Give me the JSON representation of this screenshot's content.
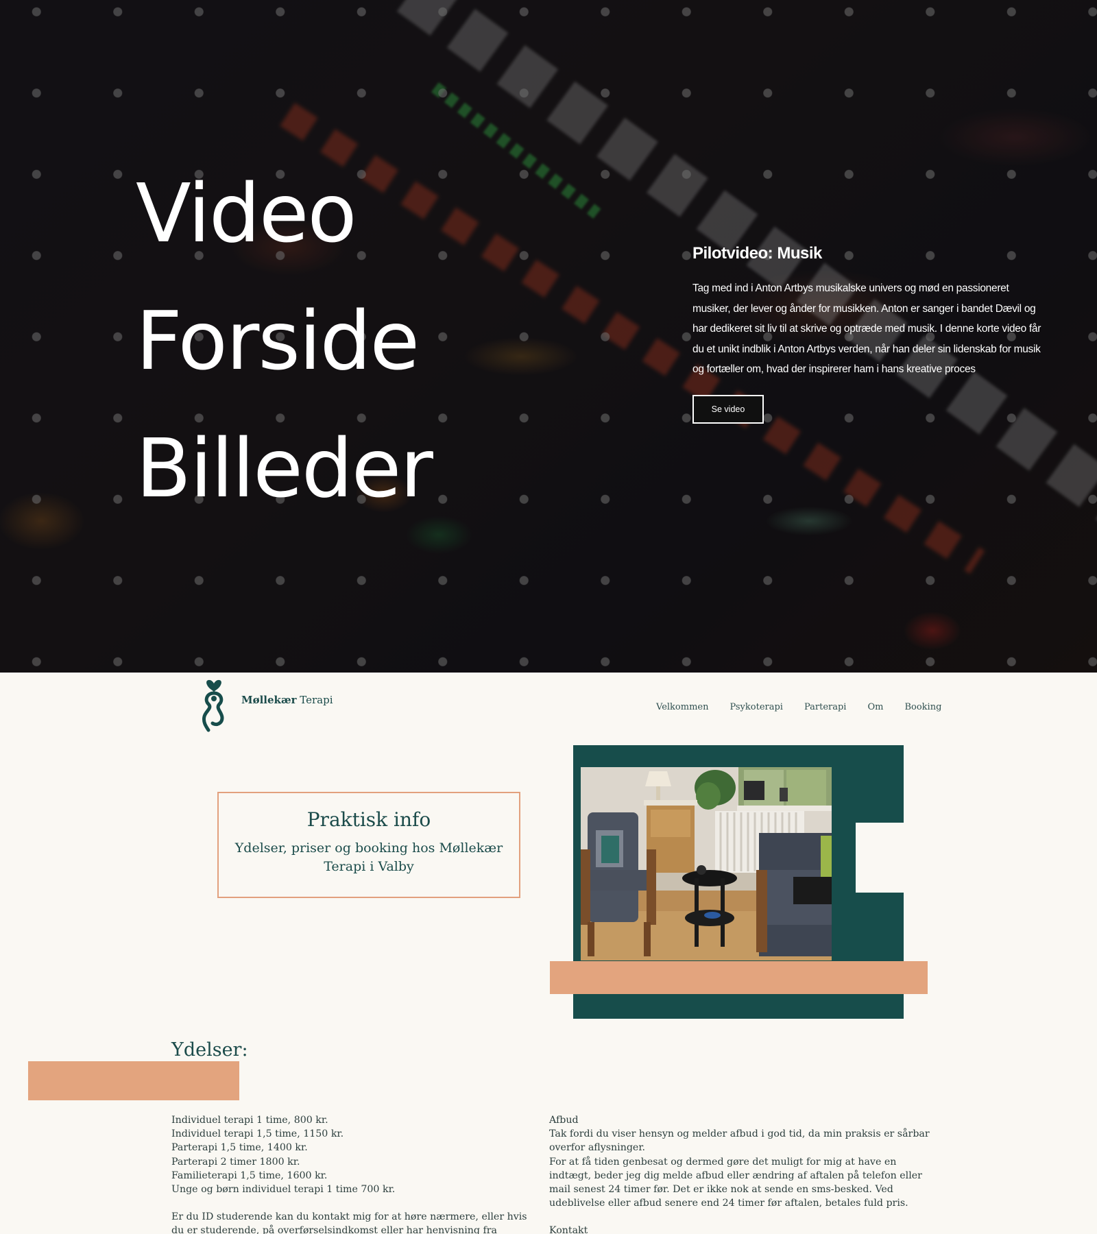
{
  "hero": {
    "title_lines": [
      "Video",
      "Forside",
      "Billeder"
    ],
    "card": {
      "heading": "Pilotvideo: Musik",
      "text": "Tag med ind i Anton Artbys musikalske univers og mød en passioneret musiker, der lever og ånder for musikken. Anton er sanger i bandet Dævil og har dedikeret sit liv til at skrive og optræde med musik. I denne korte video får du et unikt indblik i Anton Artbys verden, når han deler sin lidenskab for musik og fortæller om, hvad der inspirerer ham i hans kreative proces",
      "button_label": "Se video"
    }
  },
  "header": {
    "brand_bold": "Møllekær",
    "brand_rest": "Terapi",
    "nav": [
      "Velkommen",
      "Psykoterapi",
      "Parterapi",
      "Om",
      "Booking"
    ]
  },
  "info_box": {
    "title": "Praktisk info",
    "subtitle": "Ydelser, priser og booking hos Møllekær Terapi i Valby"
  },
  "services": {
    "heading": "Ydelser:",
    "items": [
      "Individuel terapi 1 time, 800 kr.",
      "Individuel terapi 1,5 time, 1150 kr.",
      "Parterapi 1,5 time, 1400 kr.",
      "Parterapi 2 timer 1800 kr.",
      "Familieterapi 1,5 time, 1600 kr.",
      "Unge og børn individuel terapi 1 time 700 kr."
    ],
    "note": "Er du ID studerende kan du kontakt mig for at høre nærmere, eller hvis du er studerende, på overførselsindkomst eller har henvisning fra lægen."
  },
  "cancellation": {
    "heading": "Afbud",
    "text1": "Tak fordi du viser hensyn og melder afbud i god tid, da min praksis er sårbar overfor aflysninger.",
    "text2": "For at få tiden genbesat og dermed gøre det muligt for mig at have en indtægt, beder jeg dig melde afbud eller ændring af aftalen på telefon eller mail senest 24 timer før. Det er ikke nok at sende en sms-besked. Ved udeblivelse eller afbud senere end 24 timer før aftalen, betales fuld pris.",
    "contact_heading": "Kontakt"
  },
  "colors": {
    "teal": "#174d4b",
    "peach": "#e3a47e",
    "cream": "#faf8f3"
  }
}
